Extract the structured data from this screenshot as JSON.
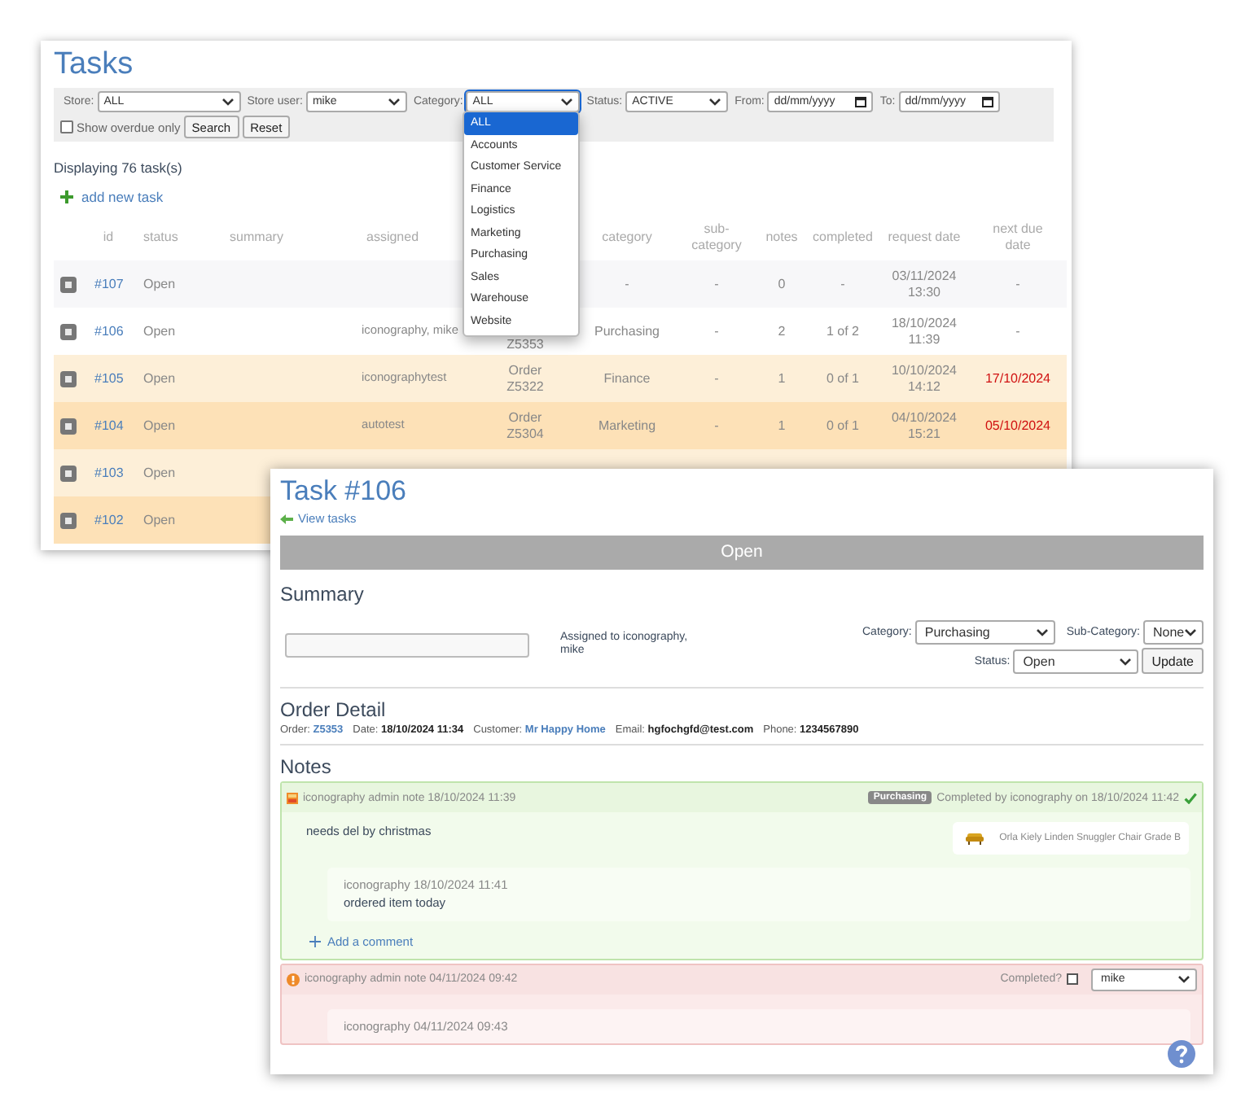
{
  "tasks_window": {
    "title": "Tasks",
    "filters": [
      {
        "kind": "select",
        "label": "Store:",
        "value": "ALL",
        "expanded": false
      },
      {
        "kind": "select",
        "label": "Store user:",
        "value": "mike",
        "expanded": false
      },
      {
        "kind": "select",
        "label": "Category:",
        "value": "ALL",
        "expanded": true
      },
      {
        "kind": "select",
        "label": "Status:",
        "value": "ACTIVE",
        "expanded": false
      },
      {
        "kind": "date",
        "label": "From:",
        "placeholder": "dd/mm/yyyy"
      },
      {
        "kind": "date",
        "label": "To:",
        "placeholder": "dd/mm/yyyy"
      }
    ],
    "overdue_only": {
      "label": "Show overdue only",
      "checked": false
    },
    "buttons": [
      "Search",
      "Reset"
    ],
    "category_options": [
      {
        "label": "ALL",
        "selected": true
      },
      {
        "label": "Accounts",
        "selected": false
      },
      {
        "label": "Customer Service",
        "selected": false
      },
      {
        "label": "Finance",
        "selected": false
      },
      {
        "label": "Logistics",
        "selected": false
      },
      {
        "label": "Marketing",
        "selected": false
      },
      {
        "label": "Purchasing",
        "selected": false
      },
      {
        "label": "Sales",
        "selected": false
      },
      {
        "label": "Warehouse",
        "selected": false
      },
      {
        "label": "Website",
        "selected": false
      }
    ],
    "count": "Displaying 76 task(s)",
    "add_link": "add new task",
    "table": {
      "columns": [
        "id",
        "status",
        "summary",
        "assigned",
        "category",
        "sub-category",
        "notes",
        "completed",
        "request date",
        "next due date"
      ],
      "rows": [
        {
          "color": "#f7f7f9",
          "id": "#107",
          "status": "Open",
          "category": "-",
          "sub_category": "-",
          "notes": "0",
          "completed": "-",
          "request_date": "03/11/2024 13:30",
          "next_due_date": "-",
          "overdue": false
        },
        {
          "color": "#ffffff",
          "id": "#106",
          "status": "Open",
          "assigned": "iconography, mike",
          "order": "Z5353",
          "category": "Purchasing",
          "sub_category": "-",
          "notes": "2",
          "completed": "1 of 2",
          "request_date": "18/10/2024 11:39",
          "next_due_date": "-",
          "overdue": false
        },
        {
          "color": "#fdefd8",
          "id": "#105",
          "status": "Open",
          "assigned": "iconographytest",
          "order": "Order Z5322",
          "category": "Finance",
          "sub_category": "-",
          "notes": "1",
          "completed": "0 of 1",
          "request_date": "10/10/2024 14:12",
          "next_due_date": "17/10/2024",
          "overdue": true
        },
        {
          "color": "#fde1b7",
          "id": "#104",
          "status": "Open",
          "assigned": "autotest",
          "order": "Order Z5304",
          "category": "Marketing",
          "sub_category": "-",
          "notes": "1",
          "completed": "0 of 1",
          "request_date": "04/10/2024 15:21",
          "next_due_date": "05/10/2024",
          "overdue": true
        },
        {
          "color": "#fdefd8",
          "id": "#103",
          "status": "Open"
        },
        {
          "color": "#fde1b7",
          "id": "#102",
          "status": "Open"
        }
      ]
    }
  },
  "task_window": {
    "title": "Task #106",
    "back_link": "View tasks",
    "status_banner": "Open",
    "summary_heading": "Summary",
    "assigned": "Assigned to iconography, mike",
    "fields": [
      {
        "label": "Category:",
        "value": "Purchasing"
      },
      {
        "label": "Sub-Category:",
        "value": "None"
      },
      {
        "label": "Status:",
        "value": "Open"
      }
    ],
    "update_button": "Update",
    "order_heading": "Order Detail",
    "order_details": [
      {
        "label": "Order:",
        "value": "Z5353",
        "kind": "link"
      },
      {
        "label": "Date:",
        "value": "18/10/2024 11:34",
        "kind": "bold"
      },
      {
        "label": "Customer:",
        "value": "Mr Happy Home",
        "kind": "link"
      },
      {
        "label": "Email:",
        "value": "hgfochgfd@test.com",
        "kind": "bold"
      },
      {
        "label": "Phone:",
        "value": "1234567890",
        "kind": "bold"
      }
    ],
    "notes_heading": "Notes",
    "notes": [
      {
        "completed": true,
        "header": "iconography admin note 18/10/2024 11:39",
        "tag": "Purchasing",
        "completed_text": "Completed by iconography on 18/10/2024 11:42",
        "body": "needs del by christmas",
        "product": "Orla Kiely Linden Snuggler Chair Grade B",
        "comments": [
          {
            "meta": "iconography 18/10/2024 11:41",
            "text": "ordered item today"
          }
        ],
        "add_comment": "Add a comment"
      },
      {
        "completed": false,
        "header": "iconography admin note 04/11/2024 09:42",
        "completed_label": "Completed?",
        "completed_checked": false,
        "assignee": "mike",
        "comments": [
          {
            "meta": "iconography 04/11/2024 09:43"
          }
        ]
      }
    ]
  }
}
